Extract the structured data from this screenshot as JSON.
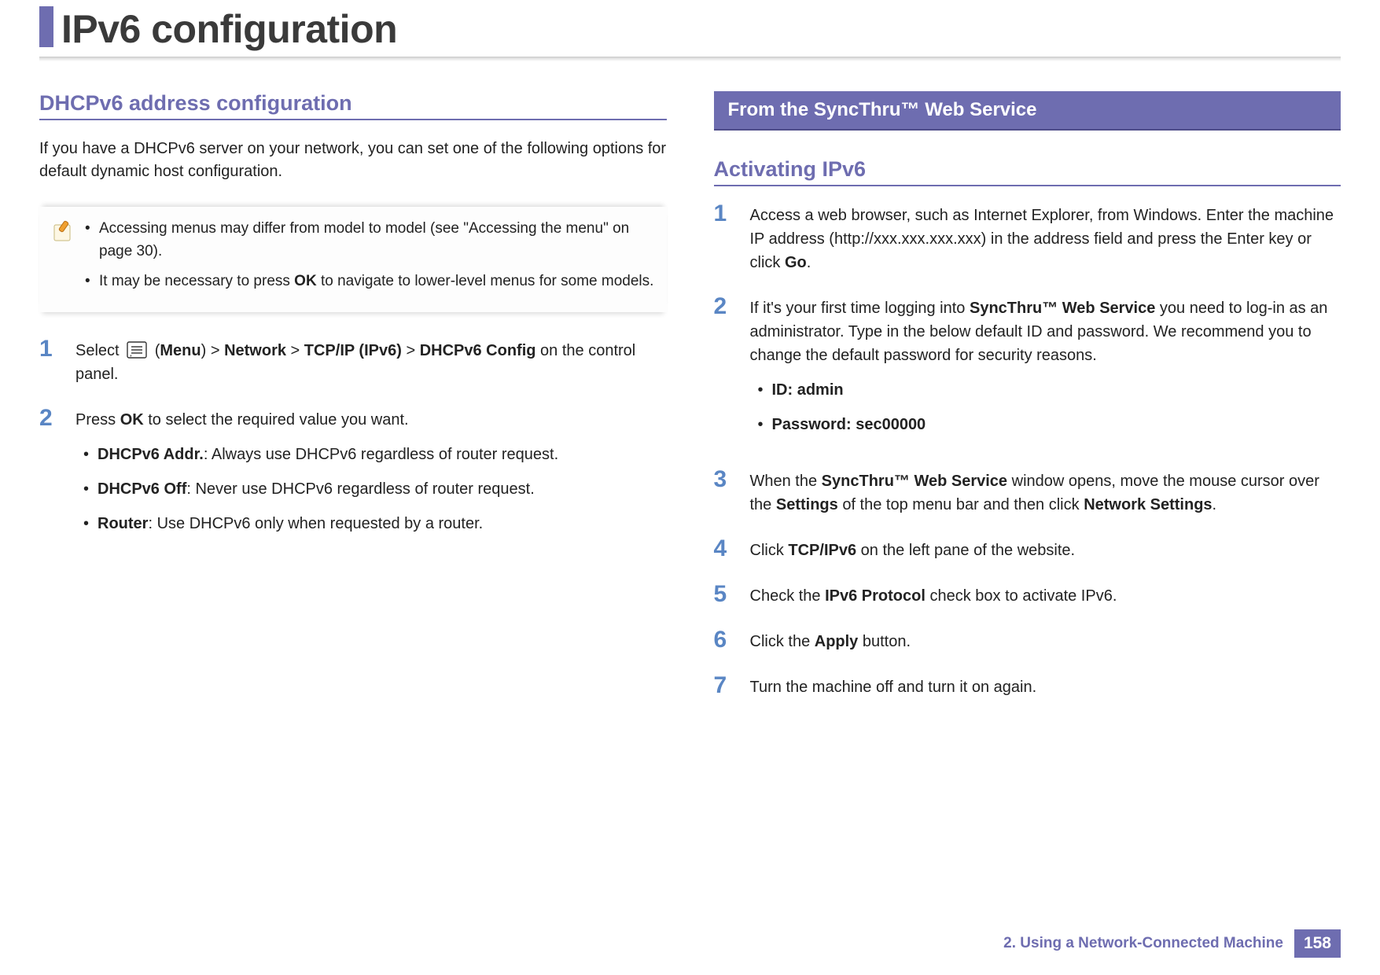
{
  "title": "IPv6 configuration",
  "left": {
    "heading": "DHCPv6 address configuration",
    "intro": "If you have a DHCPv6 server on your network, you can set one of the following options for default dynamic host configuration.",
    "note": {
      "b1a": "Accessing menus may differ from model to model (see \"Accessing the menu\" on page 30).",
      "b2a": "It may be necessary to press ",
      "b2b": "OK",
      "b2c": " to navigate to lower-level menus for some models."
    },
    "step1": {
      "a": "Select ",
      "menu_open": "(",
      "menu": "Menu",
      "menu_close": ") > ",
      "net": "Network",
      "gt1": " > ",
      "tcp": "TCP/IP (IPv6)",
      "gt2": " > ",
      "dhcp": "DHCPv6 Config",
      "tail": " on the control panel."
    },
    "step2": {
      "a": "Press ",
      "ok": "OK",
      "b": " to select the required value you want.",
      "opt1a": "DHCPv6 Addr.",
      "opt1b": ": Always use DHCPv6 regardless of router request.",
      "opt2a": "DHCPv6 Off",
      "opt2b": ": Never use DHCPv6 regardless of router request.",
      "opt3a": "Router",
      "opt3b": ": Use DHCPv6 only when requested by a router."
    }
  },
  "right": {
    "band": "From the SyncThru™ Web Service",
    "heading": "Activating IPv6",
    "s1a": "Access a web browser, such as Internet Explorer, from Windows.  Enter the machine IP address (http://xxx.xxx.xxx.xxx) in the address field and press the Enter key or click ",
    "s1b": "Go",
    "s1c": ".",
    "s2a": "If it's your first time logging into ",
    "s2b": "SyncThru™ Web Service",
    "s2c": " you need to log-in as an administrator. Type in the below default ID and password. We recommend you to change the default password for security reasons.",
    "s2id": "ID: admin",
    "s2pw": "Password: sec00000",
    "s3a": "When the ",
    "s3b": "SyncThru™ Web Service",
    "s3c": " window opens, move the mouse cursor over the ",
    "s3d": "Settings",
    "s3e": " of the top menu bar and then click ",
    "s3f": "Network Settings",
    "s3g": ".",
    "s4a": "Click ",
    "s4b": "TCP/IPv6",
    "s4c": " on the left pane of the website.",
    "s5a": "Check the ",
    "s5b": "IPv6 Protocol",
    "s5c": " check box to activate IPv6.",
    "s6a": "Click the ",
    "s6b": "Apply",
    "s6c": " button.",
    "s7": "Turn the machine off and turn it on again."
  },
  "footer": {
    "chapter": "2.  Using a Network-Connected Machine",
    "page": "158"
  },
  "nums": {
    "n1": "1",
    "n2": "2",
    "n3": "3",
    "n4": "4",
    "n5": "5",
    "n6": "6",
    "n7": "7"
  }
}
